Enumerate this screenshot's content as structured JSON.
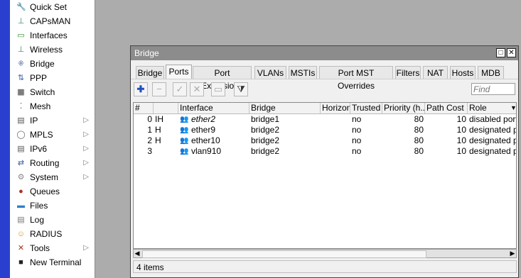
{
  "sidebar": {
    "items": [
      {
        "label": "Quick Set",
        "icon": "wrench-icon",
        "glyph": "🔧",
        "color": "#6a5b3c",
        "submenu": false
      },
      {
        "label": "CAPsMAN",
        "icon": "antenna-icon",
        "glyph": "⊥",
        "color": "#2e8b57",
        "submenu": false
      },
      {
        "label": "Interfaces",
        "icon": "interfaces-icon",
        "glyph": "▭",
        "color": "#2e8b2e",
        "submenu": false
      },
      {
        "label": "Wireless",
        "icon": "wireless-icon",
        "glyph": "⊥",
        "color": "#2e8b57",
        "submenu": false
      },
      {
        "label": "Bridge",
        "icon": "bridge-icon",
        "glyph": "⁜",
        "color": "#3a5fa0",
        "submenu": false
      },
      {
        "label": "PPP",
        "icon": "ppp-icon",
        "glyph": "⇅",
        "color": "#3a5fa0",
        "submenu": false
      },
      {
        "label": "Switch",
        "icon": "switch-icon",
        "glyph": "▦",
        "color": "#333333",
        "submenu": false
      },
      {
        "label": "Mesh",
        "icon": "mesh-icon",
        "glyph": "⁚",
        "color": "#3a5fa0",
        "submenu": false
      },
      {
        "label": "IP",
        "icon": "ip-icon",
        "glyph": "▤",
        "color": "#555555",
        "submenu": true
      },
      {
        "label": "MPLS",
        "icon": "mpls-icon",
        "glyph": "◯",
        "color": "#666666",
        "submenu": true
      },
      {
        "label": "IPv6",
        "icon": "ipv6-icon",
        "glyph": "▤",
        "color": "#555555",
        "submenu": true
      },
      {
        "label": "Routing",
        "icon": "routing-icon",
        "glyph": "⇄",
        "color": "#3a5fa0",
        "submenu": true
      },
      {
        "label": "System",
        "icon": "gear-icon",
        "glyph": "⚙",
        "color": "#888888",
        "submenu": true
      },
      {
        "label": "Queues",
        "icon": "queues-icon",
        "glyph": "●",
        "color": "#b03020",
        "submenu": false
      },
      {
        "label": "Files",
        "icon": "folder-icon",
        "glyph": "▬",
        "color": "#2f7fc8",
        "submenu": false
      },
      {
        "label": "Log",
        "icon": "log-icon",
        "glyph": "▤",
        "color": "#777777",
        "submenu": false
      },
      {
        "label": "RADIUS",
        "icon": "radius-icon",
        "glyph": "☺",
        "color": "#c89a20",
        "submenu": false
      },
      {
        "label": "Tools",
        "icon": "tools-icon",
        "glyph": "✕",
        "color": "#b03020",
        "submenu": true
      },
      {
        "label": "New Terminal",
        "icon": "terminal-icon",
        "glyph": "■",
        "color": "#222222",
        "submenu": false
      }
    ]
  },
  "window": {
    "title": "Bridge",
    "minimize_glyph": "□",
    "close_glyph": "✕"
  },
  "tabs": [
    {
      "label": "Bridge",
      "active": false
    },
    {
      "label": "Ports",
      "active": true
    },
    {
      "label": "Port Extensions",
      "active": false
    },
    {
      "label": "VLANs",
      "active": false
    },
    {
      "label": "MSTIs",
      "active": false
    },
    {
      "label": "Port MST Overrides",
      "active": false
    },
    {
      "label": "Filters",
      "active": false
    },
    {
      "label": "NAT",
      "active": false
    },
    {
      "label": "Hosts",
      "active": false
    },
    {
      "label": "MDB",
      "active": false
    }
  ],
  "toolbar": {
    "add_glyph": "✚",
    "remove_glyph": "−",
    "enable_glyph": "✓",
    "disable_glyph": "✕",
    "comment_glyph": "▭",
    "filter_glyph": "⧩",
    "find_placeholder": "Find"
  },
  "table": {
    "columns": [
      "#",
      "",
      "Interface",
      "Bridge",
      "Horizon",
      "Trusted",
      "Priority (h...",
      "Path Cost",
      "Role"
    ],
    "column_menu_glyph": "▼",
    "rows": [
      {
        "num": "0",
        "flags": "IH",
        "interface": "ether2",
        "bridge": "bridge1",
        "horizon": "",
        "trusted": "no",
        "priority": "80",
        "path_cost": "10",
        "role": "disabled port",
        "italic": true
      },
      {
        "num": "1",
        "flags": "H",
        "interface": "ether9",
        "bridge": "bridge2",
        "horizon": "",
        "trusted": "no",
        "priority": "80",
        "path_cost": "10",
        "role": "designated port",
        "italic": false
      },
      {
        "num": "2",
        "flags": "H",
        "interface": "ether10",
        "bridge": "bridge2",
        "horizon": "",
        "trusted": "no",
        "priority": "80",
        "path_cost": "10",
        "role": "designated port",
        "italic": false
      },
      {
        "num": "3",
        "flags": "",
        "interface": "vlan910",
        "bridge": "bridge2",
        "horizon": "",
        "trusted": "no",
        "priority": "80",
        "path_cost": "10",
        "role": "designated port",
        "italic": false
      }
    ],
    "interface_icon": "users-icon"
  },
  "status": {
    "items_count": "4 items"
  },
  "colors": {
    "strip": "#2b3fcf",
    "add_button": "#1f4fbf",
    "interface_icon": "#2f6db5"
  }
}
